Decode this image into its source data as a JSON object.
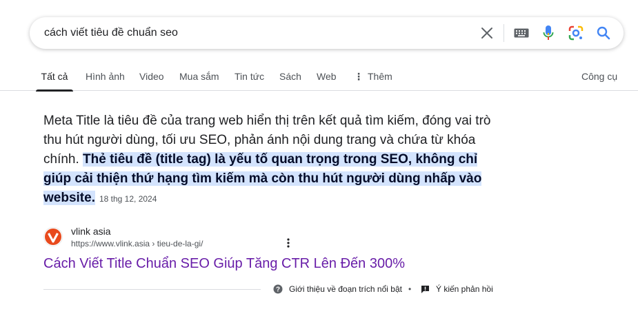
{
  "search": {
    "query": "cách viết tiêu đề chuẩn seo",
    "icons": [
      "close-icon",
      "keyboard-icon",
      "mic-icon",
      "lens-icon",
      "search-icon"
    ]
  },
  "tabs": [
    {
      "label": "Tất cả",
      "active": true
    },
    {
      "label": "Hình ảnh"
    },
    {
      "label": "Video"
    },
    {
      "label": "Mua sắm"
    },
    {
      "label": "Tin tức"
    },
    {
      "label": "Sách"
    },
    {
      "label": "Web"
    },
    {
      "label": "Thêm"
    }
  ],
  "tools_label": "Công cụ",
  "snippet": {
    "text_plain": "Meta Title là tiêu đề của trang web hiển thị trên kết quả tìm kiếm, đóng vai trò thu hút người dùng, tối ưu SEO, phản ánh nội dung trang và chứa từ khóa chính. ",
    "text_highlight": "Thẻ tiêu đề (title tag) là yếu tố quan trọng trong SEO, không chỉ giúp cải thiện thứ hạng tìm kiếm mà còn thu hút người dùng nhấp vào website.",
    "date": "18 thg 12, 2024"
  },
  "source": {
    "name": "vlink asia",
    "url": "https://www.vlink.asia › tieu-de-la-gi/",
    "title": "Cách Viết Title Chuẩn SEO Giúp Tăng CTR Lên Đến 300%"
  },
  "footer": {
    "about": "Giới thiệu về đoạn trích nổi bật",
    "separator": "•",
    "feedback": "Ý kiến phản hồi"
  },
  "colors": {
    "link_visited": "#681da8",
    "highlight_bg": "#d3e3fd",
    "google_blue": "#4285f4",
    "google_red": "#ea4335",
    "google_yellow": "#fbbc04",
    "google_green": "#34a853"
  }
}
